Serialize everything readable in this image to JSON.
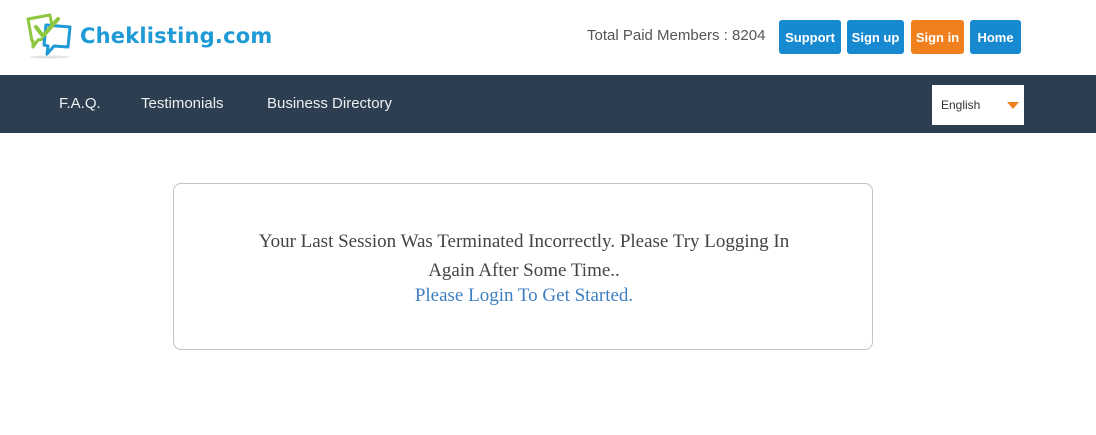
{
  "header": {
    "logo_text": "Cheklisting.com",
    "members_text": "Total Paid Members : 8204",
    "buttons": {
      "support": "Support",
      "signup": "Sign up",
      "signin": "Sign in",
      "home": "Home"
    }
  },
  "nav": {
    "items": [
      "F.A.Q.",
      "Testimonials",
      "Business Directory"
    ],
    "language": {
      "selected": "English"
    }
  },
  "main": {
    "message": "Your Last Session Was Terminated Incorrectly. Please Try Logging In Again After Some Time..",
    "login_link": "Please Login To Get Started."
  },
  "colors": {
    "brand_blue": "#1689d1",
    "accent_orange": "#f07f1e",
    "navbar_bg": "#2c3e50",
    "link_blue": "#3d7fc1",
    "logo_green": "#8dc63f"
  },
  "icons": {
    "logo": "chat-bubbles-checkmark-icon",
    "language_dropdown": "caret-down-icon"
  }
}
